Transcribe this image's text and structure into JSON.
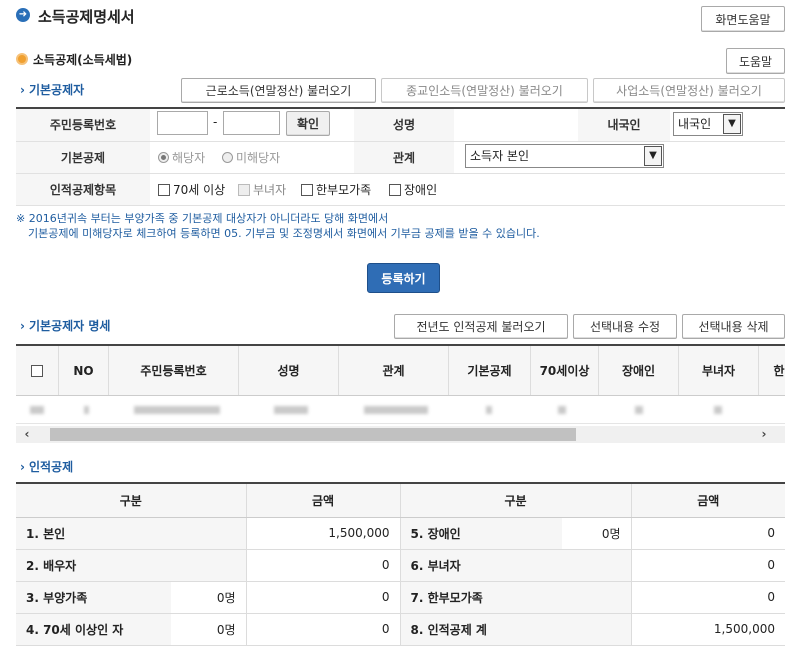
{
  "page": {
    "title": "소득공제명세서",
    "help_button": "화면도움말",
    "subtitle": "소득공제(소득세법)",
    "sub_help_button": "도움말"
  },
  "basic": {
    "section_title": "기본공제자",
    "load_buttons": [
      "근로소득(연말정산) 불러오기",
      "종교인소득(연말정산) 불러오기",
      "사업소득(연말정산) 불러오기"
    ],
    "labels": {
      "rrn": "주민등록번호",
      "name": "성명",
      "nationality": "내국인",
      "deduction": "기본공제",
      "relation": "관계",
      "personal_items": "인적공제항목"
    },
    "rrn_separator": "-",
    "confirm_button": "확인",
    "nationality_value": "내국인",
    "deduction_options": [
      "해당자",
      "미해당자"
    ],
    "relation_value": "소득자 본인",
    "checkboxes": [
      "70세 이상",
      "부녀자",
      "한부모가족",
      "장애인"
    ],
    "note_lines": [
      "※ 2016년귀속 부터는 부양가족 중 기본공제 대상자가 아니더라도 당해 화면에서",
      "기본공제에 미해당자로 체크하여 등록하면 05. 기부금 및 조정명세서 화면에서 기부금 공제를 받을 수 있습니다."
    ],
    "register_button": "등록하기"
  },
  "list": {
    "section_title": "기본공제자 명세",
    "buttons": [
      "전년도 인적공제 불러오기",
      "선택내용 수정",
      "선택내용 삭제"
    ],
    "columns": [
      "NO",
      "주민등록번호",
      "성명",
      "관계",
      "기본공제",
      "70세이상",
      "장애인",
      "부녀자",
      "한"
    ]
  },
  "personal": {
    "section_title": "인적공제",
    "headers": [
      "구분",
      "금액",
      "구분",
      "금액"
    ],
    "rows": [
      {
        "l_label": "1. 본인",
        "l_count": "",
        "l_amount": "1,500,000",
        "r_label": "5. 장애인",
        "r_count": "0명",
        "r_amount": "0"
      },
      {
        "l_label": "2. 배우자",
        "l_count": "",
        "l_amount": "0",
        "r_label": "6. 부녀자",
        "r_count": "",
        "r_amount": "0"
      },
      {
        "l_label": "3. 부양가족",
        "l_count": "0명",
        "l_amount": "0",
        "r_label": "7. 한부모가족",
        "r_count": "",
        "r_amount": "0"
      },
      {
        "l_label": "4. 70세 이상인 자",
        "l_count": "0명",
        "l_amount": "0",
        "r_label": "8. 인적공제 계",
        "r_count": "",
        "r_amount": "1,500,000"
      }
    ]
  },
  "colors": {
    "accent": "#1f5da0",
    "register_button": "#2f6db5"
  }
}
